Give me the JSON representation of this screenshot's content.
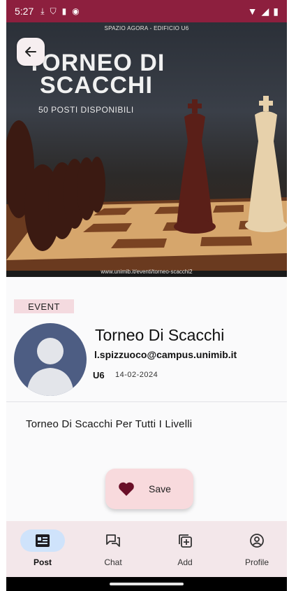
{
  "status_bar": {
    "time": "5:27",
    "icons": [
      "download-icon",
      "shield-off-icon",
      "sd-card-icon",
      "circle-icon"
    ],
    "right_icons": [
      "wifi-icon",
      "signal-icon",
      "battery-icon"
    ],
    "color": "#8d1f3e"
  },
  "hero": {
    "top_caption": "SPAZIO AGORA - EDIFICIO U6",
    "title_line1": "TORNEO DI",
    "title_line2": "SCACCHI",
    "subtitle": "50 POSTI DISPONIBILI",
    "url": "www.unimib.it/eventi/torneo-scacchi2"
  },
  "event": {
    "badge": "EVENT",
    "title": "Torneo Di Scacchi",
    "email": "l.spizzuoco@campus.unimib.it",
    "room": "U6",
    "date": "14-02-2024",
    "description": "Torneo Di Scacchi Per Tutti I Livelli"
  },
  "actions": {
    "save_label": "Save"
  },
  "nav": {
    "items": [
      {
        "label": "Post",
        "icon": "post-icon",
        "active": true
      },
      {
        "label": "Chat",
        "icon": "chat-icon",
        "active": false
      },
      {
        "label": "Add",
        "icon": "add-icon",
        "active": false
      },
      {
        "label": "Profile",
        "icon": "profile-icon",
        "active": false
      }
    ]
  },
  "colors": {
    "accent": "#8d1f3e",
    "badge_bg": "#f4dadf",
    "save_bg": "#f8dadd",
    "nav_bg": "#f3e7ea",
    "nav_active": "#cfe3fb",
    "avatar_bg": "#4d5d83"
  }
}
